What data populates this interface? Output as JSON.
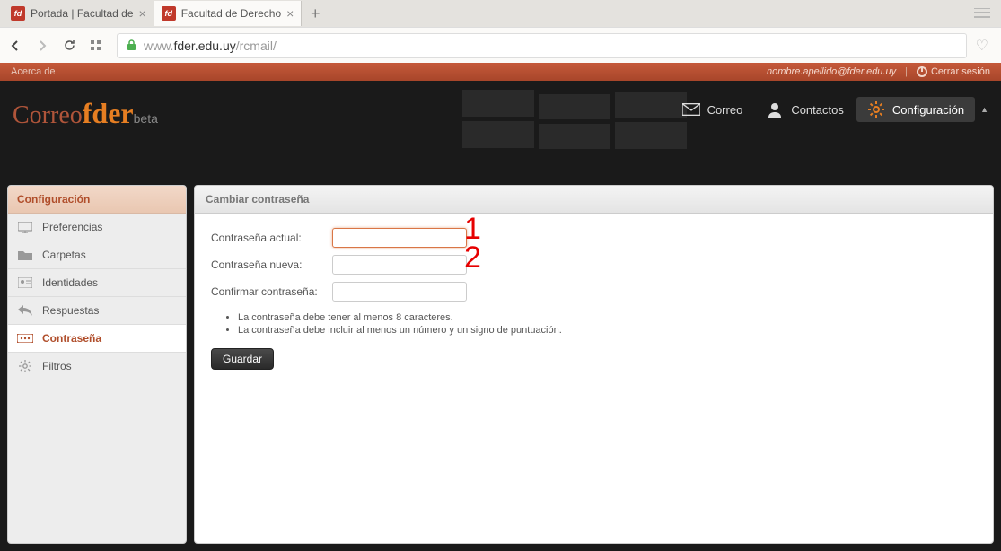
{
  "browser": {
    "tabs": [
      {
        "title": "Portada | Facultad de",
        "active": false
      },
      {
        "title": "Facultad de Derecho",
        "active": true
      }
    ],
    "url_prefix": "www.",
    "url_domain": "fder.edu.uy",
    "url_path": "/rcmail/"
  },
  "topbar": {
    "about": "Acerca de",
    "user": "nombre.apellido@fder.edu.uy",
    "logout": "Cerrar sesión"
  },
  "logo": {
    "part1": "Correo",
    "part2": "fder",
    "part3": "beta"
  },
  "mainnav": {
    "mail": "Correo",
    "contacts": "Contactos",
    "settings": "Configuración"
  },
  "sidebar": {
    "header": "Configuración",
    "items": [
      {
        "label": "Preferencias",
        "icon": "monitor"
      },
      {
        "label": "Carpetas",
        "icon": "folder"
      },
      {
        "label": "Identidades",
        "icon": "card"
      },
      {
        "label": "Respuestas",
        "icon": "reply"
      },
      {
        "label": "Contraseña",
        "icon": "password",
        "active": true
      },
      {
        "label": "Filtros",
        "icon": "gear"
      }
    ]
  },
  "content": {
    "header": "Cambiar contraseña",
    "labels": {
      "current": "Contraseña actual:",
      "new": "Contraseña nueva:",
      "confirm": "Confirmar contraseña:"
    },
    "rules": [
      "La contraseña debe tener al menos 8 caracteres.",
      "La contraseña debe incluir al menos un número y un signo de puntuación."
    ],
    "save": "Guardar"
  },
  "annotations": {
    "one": "1",
    "two": "2"
  }
}
